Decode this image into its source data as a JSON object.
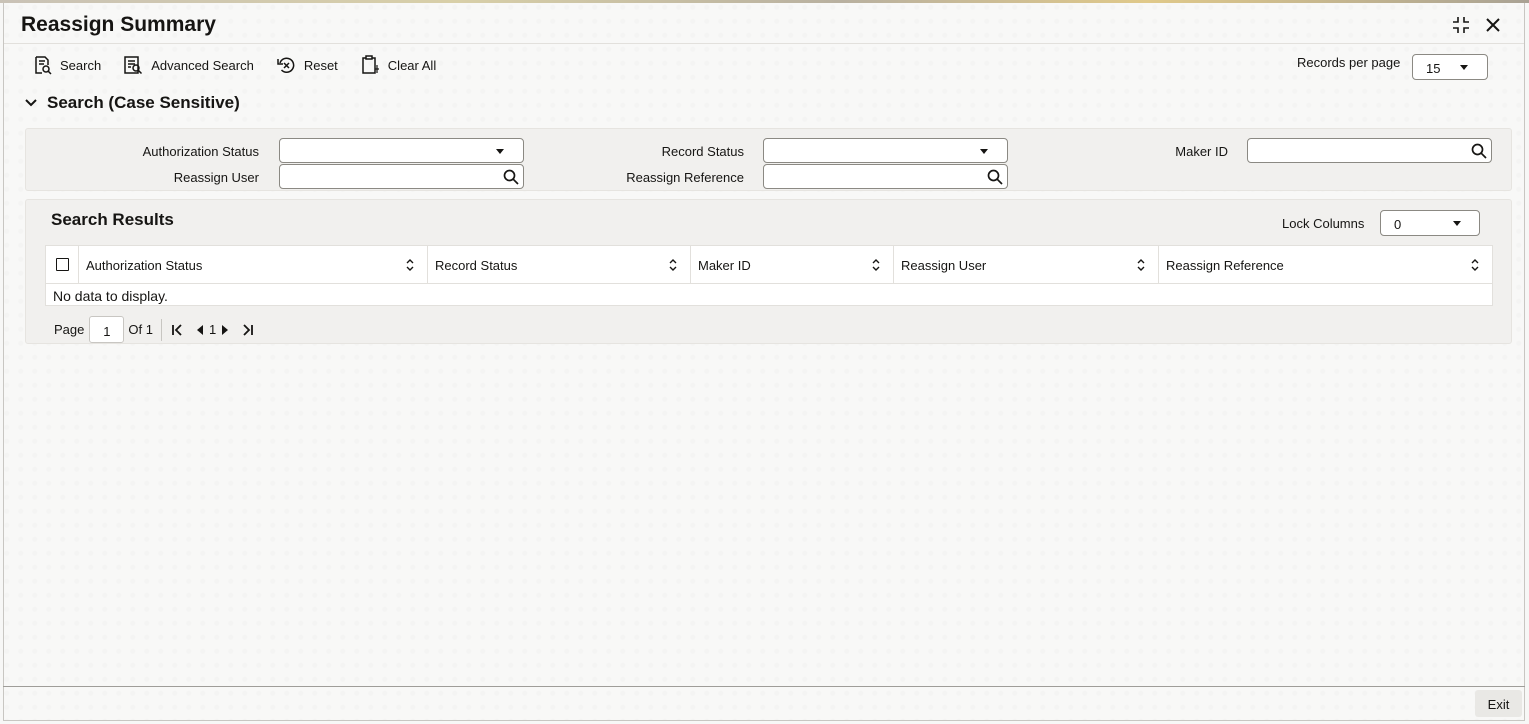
{
  "window": {
    "title": "Reassign Summary"
  },
  "toolbar": {
    "search_label": "Search",
    "advanced_search_label": "Advanced Search",
    "reset_label": "Reset",
    "clear_all_label": "Clear All"
  },
  "records_per_page": {
    "label": "Records per page",
    "value": "15"
  },
  "search_section": {
    "title": "Search (Case Sensitive)",
    "fields": {
      "authorization_status": {
        "label": "Authorization Status",
        "value": ""
      },
      "record_status": {
        "label": "Record Status",
        "value": ""
      },
      "maker_id": {
        "label": "Maker ID",
        "value": ""
      },
      "reassign_user": {
        "label": "Reassign User",
        "value": ""
      },
      "reassign_reference": {
        "label": "Reassign Reference",
        "value": ""
      }
    }
  },
  "results": {
    "title": "Search Results",
    "lock_columns": {
      "label": "Lock Columns",
      "value": "0"
    },
    "columns": [
      "Authorization Status",
      "Record Status",
      "Maker ID",
      "Reassign User",
      "Reassign Reference"
    ],
    "empty_text": "No data to display."
  },
  "pager": {
    "page_label": "Page",
    "page_value": "1",
    "of_label": "Of 1",
    "current": "1"
  },
  "footer": {
    "exit_label": "Exit"
  },
  "icons": [
    "search-doc-icon",
    "advanced-search-icon",
    "reset-icon",
    "clear-all-icon",
    "collapse-icon",
    "close-icon",
    "chevron-down-icon",
    "magnifier-icon",
    "sort-icon",
    "first-page-icon",
    "prev-page-icon",
    "next-page-icon",
    "last-page-icon"
  ]
}
